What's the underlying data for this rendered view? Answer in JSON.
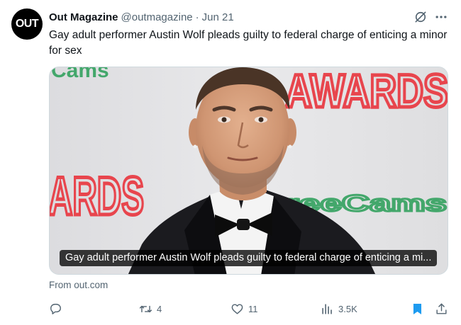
{
  "tweet": {
    "avatar_text": "OUT",
    "author_name": "Out Magazine",
    "author_handle": "@outmagazine",
    "separator": "·",
    "date": "Jun 21",
    "text": "Gay adult performer Austin Wolf pleads guilty to federal charge of enticing a minor for sex",
    "card": {
      "caption": "Gay adult performer Austin Wolf pleads guilty to federal charge of enticing a mi...",
      "backdrop_text": {
        "top_left": "Cams",
        "top_right": "AWARDS",
        "middle_left": "ARDS",
        "middle_right": "reeCams"
      }
    },
    "source": "From out.com",
    "actions": {
      "replies": "",
      "retweets": "4",
      "likes": "11",
      "views": "3.5K"
    },
    "colors": {
      "muted": "#536471",
      "bookmark_active": "#1d9bf0",
      "backdrop_red": "#e8454d",
      "backdrop_green": "#43a76b"
    },
    "icons": [
      "grok-icon",
      "more-icon",
      "reply-icon",
      "retweet-icon",
      "like-icon",
      "views-icon",
      "bookmark-icon",
      "share-icon"
    ]
  }
}
